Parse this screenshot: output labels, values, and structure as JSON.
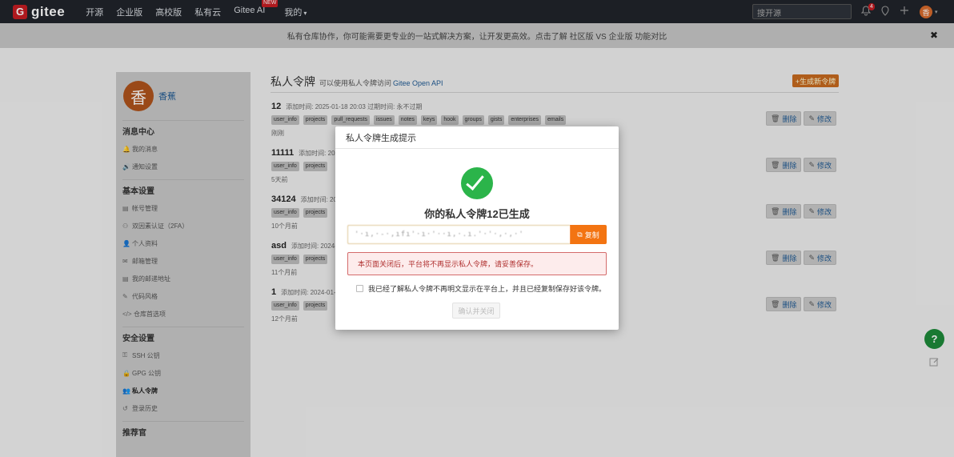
{
  "nav": {
    "logo_mark": "G",
    "logo_text": "gitee",
    "items": [
      "开源",
      "企业版",
      "高校版",
      "私有云",
      "Gitee AI",
      "我的"
    ],
    "new_badge": "NEW",
    "search_placeholder": "搜开源",
    "notif_count": "4",
    "avatar_char": "香"
  },
  "banner": {
    "text": "私有仓库协作，你可能需要更专业的一站式解决方案，让开发更高效。点击了解 社区版 VS 企业版 功能对比",
    "close": "✖"
  },
  "sidebar": {
    "avatar_char": "香",
    "user_name": "香蕉",
    "sections": [
      {
        "title": "消息中心",
        "items": [
          {
            "icon": "bell-icon",
            "glyph": "🔔",
            "label": "我的消息"
          },
          {
            "icon": "volume-icon",
            "glyph": "🔊",
            "label": "通知设置"
          }
        ]
      },
      {
        "title": "基本设置",
        "items": [
          {
            "icon": "id-card-icon",
            "glyph": "▤",
            "label": "帐号管理"
          },
          {
            "icon": "shield-user-icon",
            "glyph": "⚇",
            "label": "双因素认证（2FA）"
          },
          {
            "icon": "user-icon",
            "glyph": "👤",
            "label": "个人资料"
          },
          {
            "icon": "mail-icon",
            "glyph": "✉",
            "label": "邮箱管理"
          },
          {
            "icon": "address-icon",
            "glyph": "▤",
            "label": "我的邮递地址"
          },
          {
            "icon": "brush-icon",
            "glyph": "✎",
            "label": "代码风格"
          },
          {
            "icon": "code-icon",
            "glyph": "</>",
            "label": "仓库首选项"
          }
        ]
      },
      {
        "title": "安全设置",
        "items": [
          {
            "icon": "key-icon",
            "glyph": "⚿",
            "label": "SSH 公钥"
          },
          {
            "icon": "lock-icon",
            "glyph": "🔒",
            "label": "GPG 公钥"
          },
          {
            "icon": "token-icon",
            "glyph": "👥",
            "label": "私人令牌",
            "active": true
          },
          {
            "icon": "history-icon",
            "glyph": "↺",
            "label": "登录历史"
          }
        ]
      },
      {
        "title": "推荐官",
        "items": []
      }
    ]
  },
  "main": {
    "title": "私人令牌",
    "subtitle": "可以使用私人令牌访问",
    "subtitle_link": "Gitee Open API",
    "generate_btn": "+生成新令牌",
    "delete_label": "删除",
    "edit_label": "修改",
    "tokens": [
      {
        "name": "12",
        "meta": "添加时间: 2025-01-18 20:03    过期时间: 永不过期",
        "tags": [
          "user_info",
          "projects",
          "pull_requests",
          "issues",
          "notes",
          "keys",
          "hook",
          "groups",
          "gists",
          "enterprises",
          "emails"
        ],
        "age": "刚刚"
      },
      {
        "name": "11111",
        "meta": "添加时间: 2025",
        "tags": [
          "user_info",
          "projects"
        ],
        "age": "5天前"
      },
      {
        "name": "34124",
        "meta": "添加时间: 2024",
        "tags": [
          "user_info",
          "projects"
        ],
        "age": "10个月前"
      },
      {
        "name": "asd",
        "meta": "添加时间: 2024-03",
        "tags": [
          "user_info",
          "projects"
        ],
        "age": "11个月前"
      },
      {
        "name": "1",
        "meta": "添加时间: 2024-01-30",
        "tags": [
          "user_info",
          "projects"
        ],
        "age": "12个月前"
      }
    ]
  },
  "modal": {
    "title": "私人令牌生成提示",
    "heading": "你的私人令牌12已生成",
    "token_value": "'·ı,·-·,ıfı'·ı·'··ı,·.ı.'·'·,·,·'",
    "copy_label": "复制",
    "warning": "本页面关闭后，平台将不再显示私人令牌，请妥善保存。",
    "agree_text": "我已经了解私人令牌不再明文显示在平台上，并且已经复制保存好该令牌。",
    "confirm_label": "确认并关闭"
  }
}
